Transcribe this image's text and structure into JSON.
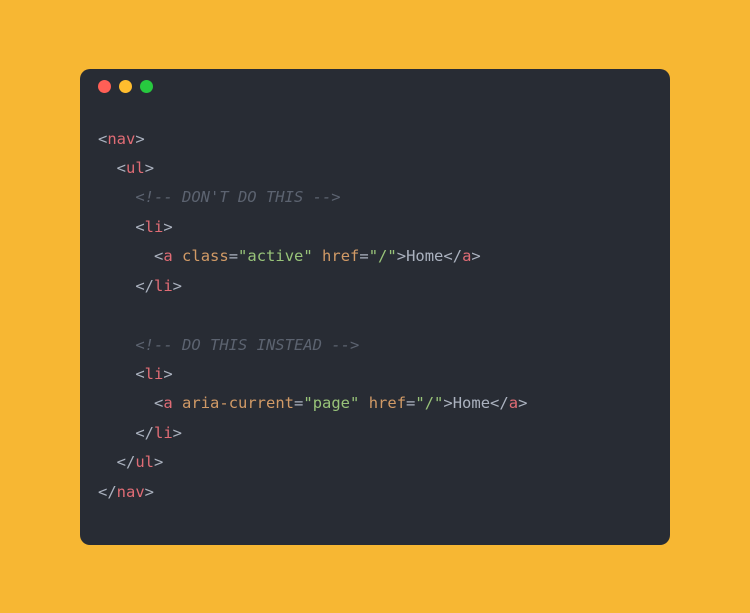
{
  "colors": {
    "page_bg": "#f7b733",
    "window_bg": "#282c34",
    "punctuation": "#abb2bf",
    "tag": "#e06c75",
    "attr": "#d19a66",
    "string": "#98c379",
    "text": "#abb2bf",
    "comment": "#5c6370",
    "traffic_red": "#ff5f56",
    "traffic_yellow": "#ffbd2e",
    "traffic_green": "#27c93f"
  },
  "code": {
    "tags": {
      "nav": "nav",
      "ul": "ul",
      "li": "li",
      "a": "a"
    },
    "attrs": {
      "class": "class",
      "href": "href",
      "aria_current": "aria-current"
    },
    "strings": {
      "active": "\"active\"",
      "slash": "\"/\"",
      "page": "\"page\""
    },
    "text": {
      "home": "Home"
    },
    "comments": {
      "dont": "<!-- DON'T DO THIS -->",
      "do": "<!-- DO THIS INSTEAD -->"
    },
    "punc": {
      "lt": "<",
      "gt": ">",
      "lt_sl": "</",
      "eq": "="
    }
  }
}
